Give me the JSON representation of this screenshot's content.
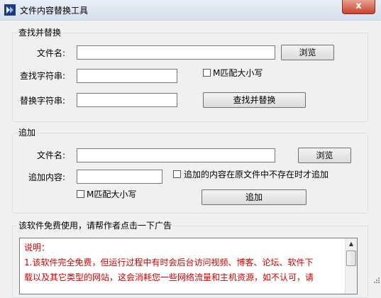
{
  "window": {
    "title": "文件内容替换工具",
    "close_label": "x"
  },
  "group_replace": {
    "title": "查找并替换",
    "file_label": "文件名:",
    "file_value": "",
    "browse_label": "浏览",
    "find_label": "查找字符串:",
    "find_value": "",
    "match_case_label": "M匹配大小写",
    "replace_label": "替换字符串:",
    "replace_value": "",
    "find_replace_button": "查找并替换"
  },
  "group_append": {
    "title": "追加",
    "file_label": "文件名:",
    "file_value": "",
    "browse_label": "浏览",
    "append_label": "追加内容:",
    "append_value": "",
    "append_if_missing_label": "追加的内容在原文件中不存在时才追加",
    "match_case_label": "M匹配大小写",
    "append_button": "追加"
  },
  "group_ad": {
    "title": "该软件免费使用，请帮作者点击一下广告",
    "note_lines": [
      "说明：",
      "1.该软件完全免费，但运行过程中有时会后台访问视频、博客、论坛、软件下",
      "载以及其它类型的网站，这会消耗您一些网络流量和主机资源，如不认可，请"
    ]
  }
}
